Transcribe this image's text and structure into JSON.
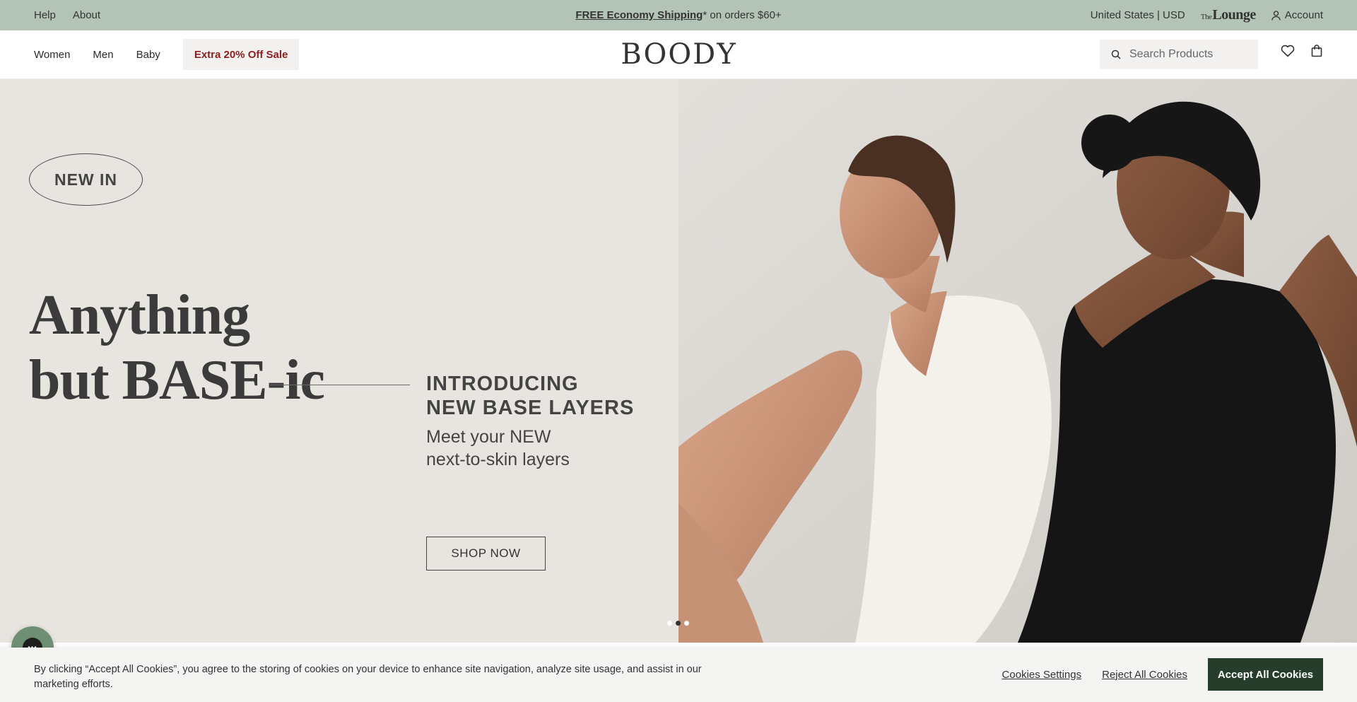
{
  "topbar": {
    "links": [
      "Help",
      "About"
    ],
    "promo_bold": "FREE Economy Shipping",
    "promo_rest": "* on orders $60+",
    "locale": "United States | USD",
    "lounge_small": "The",
    "lounge_big": "Lounge",
    "account": "Account"
  },
  "nav": {
    "items": [
      "Women",
      "Men",
      "Baby"
    ],
    "sale": "Extra 20% Off Sale"
  },
  "logo": "BOODY",
  "search": {
    "placeholder": "Search Products"
  },
  "hero": {
    "badge": "NEW IN",
    "headline_line1": "Anything",
    "headline_line2": "but BASE-ic",
    "intro_line1": "INTRODUCING",
    "intro_line2": "NEW BASE LAYERS",
    "sub_line1": "Meet your NEW",
    "sub_line2": "next-to-skin layers",
    "cta": "SHOP NOW",
    "slides_total": 3,
    "slide_active": 2
  },
  "cookie": {
    "text": "By clicking “Accept All Cookies”, you agree to the storing of cookies on your device to enhance site navigation, analyze site usage, and assist in our marketing efforts.",
    "settings": "Cookies Settings",
    "reject": "Reject All Cookies",
    "accept": "Accept All Cookies"
  },
  "colors": {
    "topbar": "#b3c4b7",
    "hero_bg": "#e8e5e1",
    "sale_text": "#8b1e1e",
    "accept_bg": "#253d2a"
  },
  "icons": [
    "search-icon",
    "heart-icon",
    "bag-icon",
    "user-icon",
    "chat-icon"
  ]
}
